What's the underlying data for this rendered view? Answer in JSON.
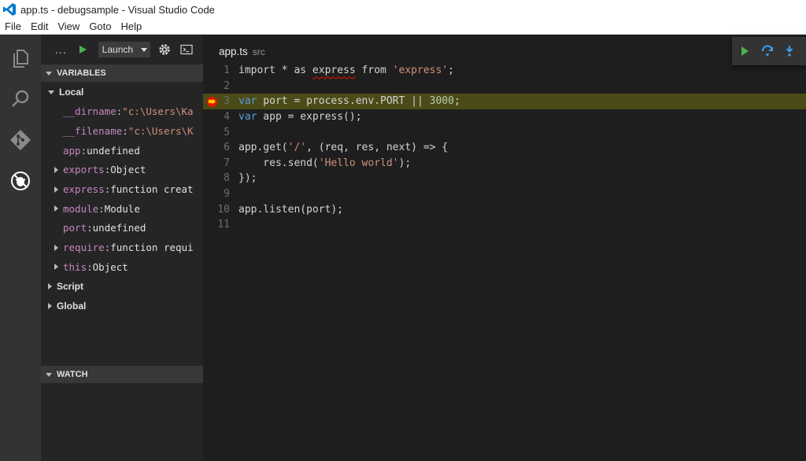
{
  "window": {
    "title": "app.ts - debugsample - Visual Studio Code"
  },
  "menu": [
    "File",
    "Edit",
    "View",
    "Goto",
    "Help"
  ],
  "activity_icons": [
    "files-icon",
    "search-icon",
    "git-icon",
    "debug-icon"
  ],
  "debug_toolbar": {
    "dots": "...",
    "config_selected": "Launch"
  },
  "variables": {
    "header": "VARIABLES",
    "scopes": [
      {
        "label": "Local",
        "expanded": true,
        "items": [
          {
            "name": "__dirname",
            "value": "\"c:\\Users\\Ka",
            "kind": "string",
            "expandable": false
          },
          {
            "name": "__filename",
            "value": "\"c:\\Users\\K",
            "kind": "string",
            "expandable": false
          },
          {
            "name": "app",
            "value": "undefined",
            "kind": "plain",
            "expandable": false
          },
          {
            "name": "exports",
            "value": "Object",
            "kind": "plain",
            "expandable": true
          },
          {
            "name": "express",
            "value": "function creat",
            "kind": "plain",
            "expandable": true
          },
          {
            "name": "module",
            "value": "Module",
            "kind": "plain",
            "expandable": true
          },
          {
            "name": "port",
            "value": "undefined",
            "kind": "plain",
            "expandable": false
          },
          {
            "name": "require",
            "value": "function requi",
            "kind": "plain",
            "expandable": true
          },
          {
            "name": "this",
            "value": "Object",
            "kind": "plain",
            "expandable": true
          }
        ]
      },
      {
        "label": "Script",
        "expanded": false,
        "items": []
      },
      {
        "label": "Global",
        "expanded": false,
        "items": []
      }
    ]
  },
  "watch": {
    "header": "WATCH"
  },
  "editor": {
    "file_name": "app.ts",
    "file_path": "src",
    "current_line": 3,
    "breakpoint_line": 3,
    "lines": [
      {
        "n": "1",
        "tokens": [
          [
            "t",
            "import * as "
          ],
          [
            "sq",
            "express"
          ],
          [
            "t",
            " from "
          ],
          [
            "s",
            "'express'"
          ],
          [
            "t",
            ";"
          ]
        ]
      },
      {
        "n": "2",
        "tokens": []
      },
      {
        "n": "3",
        "tokens": [
          [
            "k",
            "var"
          ],
          [
            "t",
            " port = process.env.PORT || "
          ],
          [
            "n",
            "3000"
          ],
          [
            "t",
            ";"
          ]
        ]
      },
      {
        "n": "4",
        "tokens": [
          [
            "k",
            "var"
          ],
          [
            "t",
            " app = express();"
          ]
        ]
      },
      {
        "n": "5",
        "tokens": []
      },
      {
        "n": "6",
        "tokens": [
          [
            "t",
            "app.get("
          ],
          [
            "s",
            "'/'"
          ],
          [
            "t",
            ", (req, res, next) => {"
          ]
        ]
      },
      {
        "n": "7",
        "tokens": [
          [
            "t",
            "    res.send("
          ],
          [
            "s",
            "'Hello world'"
          ],
          [
            "t",
            ");"
          ]
        ]
      },
      {
        "n": "8",
        "tokens": [
          [
            "t",
            "});"
          ]
        ]
      },
      {
        "n": "9",
        "tokens": []
      },
      {
        "n": "10",
        "tokens": [
          [
            "t",
            "app.listen(port);"
          ]
        ]
      },
      {
        "n": "11",
        "tokens": []
      }
    ]
  },
  "debug_float_icons": [
    "continue-icon",
    "step-over-icon",
    "step-into-icon"
  ],
  "colors": {
    "activity_bar": "#333333",
    "sidebar": "#252526",
    "editor": "#1e1e1e",
    "current_line": "#4b4b18",
    "keyword": "#569cd6",
    "string": "#ce9178",
    "number": "#b5cea8",
    "variable_name": "#c586c0",
    "breakpoint": "#e51400",
    "run_green": "#4fb04f"
  }
}
